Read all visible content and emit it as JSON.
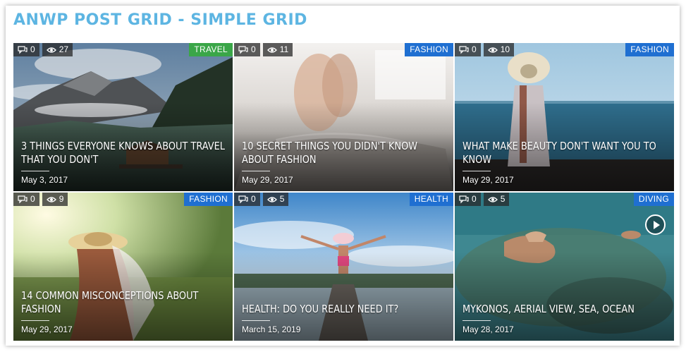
{
  "widget": {
    "title": "ANWP POST GRID - SIMPLE GRID"
  },
  "colors": {
    "title": "#5db5e2",
    "travel_badge": "#3aa648",
    "category_badge": "#1f6fd1"
  },
  "posts": [
    {
      "comments": "0",
      "views": "27",
      "category": "TRAVEL",
      "title": "3 THINGS EVERYONE KNOWS ABOUT TRAVEL THAT YOU DON'T",
      "date": "May 3, 2017"
    },
    {
      "comments": "0",
      "views": "11",
      "category": "FASHION",
      "title": "10 SECRET THINGS YOU DIDN'T KNOW ABOUT FASHION",
      "date": "May 29, 2017"
    },
    {
      "comments": "0",
      "views": "10",
      "category": "FASHION",
      "title": "WHAT MAKE BEAUTY DON'T WANT YOU TO KNOW",
      "date": "May 29, 2017"
    },
    {
      "comments": "0",
      "views": "9",
      "category": "FASHION",
      "title": "14 COMMON MISCONCEPTIONS ABOUT FASHION",
      "date": "May 29, 2017"
    },
    {
      "comments": "0",
      "views": "5",
      "category": "HEALTH",
      "title": "HEALTH: DO YOU REALLY NEED IT?",
      "date": "March 15, 2019"
    },
    {
      "comments": "0",
      "views": "5",
      "category": "DIVING",
      "title": "MYKONOS, AERIAL VIEW, SEA, OCEAN",
      "date": "May 28, 2017"
    }
  ]
}
